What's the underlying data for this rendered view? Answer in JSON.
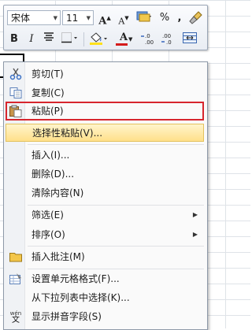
{
  "mini_toolbar": {
    "font_name": "宋体",
    "font_size": "11",
    "row1_icons": [
      "grow-font-icon",
      "shrink-font-icon",
      "accounting-format-icon",
      "percent-icon",
      "comma-style-icon",
      "format-painter-icon"
    ],
    "percent": "%",
    "comma": ",",
    "bold": "B",
    "italic": "I",
    "grow_a": "A",
    "shrink_a": "A",
    "font_color_a": "A",
    "inc_decimal": "+.0 .00",
    "dec_decimal": ".00 +.0",
    "font_color": "#d41b1b",
    "fill_color": "#ffe11a"
  },
  "context_menu": {
    "items": [
      {
        "label": "剪切(T)",
        "icon": "scissors-icon"
      },
      {
        "label": "复制(C)",
        "icon": "copy-icon"
      },
      {
        "label": "粘贴(P)",
        "icon": "paste-icon"
      },
      {
        "label": "选择性粘贴(V)...",
        "icon": ""
      },
      {
        "label": "插入(I)...",
        "icon": ""
      },
      {
        "label": "删除(D)...",
        "icon": ""
      },
      {
        "label": "清除内容(N)",
        "icon": ""
      },
      {
        "label": "筛选(E)",
        "icon": "",
        "submenu": "▶"
      },
      {
        "label": "排序(O)",
        "icon": "",
        "submenu": "▶"
      },
      {
        "label": "插入批注(M)",
        "icon": "comment-icon"
      },
      {
        "label": "设置单元格格式(F)...",
        "icon": "format-cells-icon"
      },
      {
        "label": "从下拉列表中选择(K)...",
        "icon": ""
      },
      {
        "label": "显示拼音字段(S)",
        "icon": "phonetic-icon"
      }
    ],
    "phonetic_icon_text_top": "wén",
    "phonetic_icon_text_bottom": "文"
  }
}
